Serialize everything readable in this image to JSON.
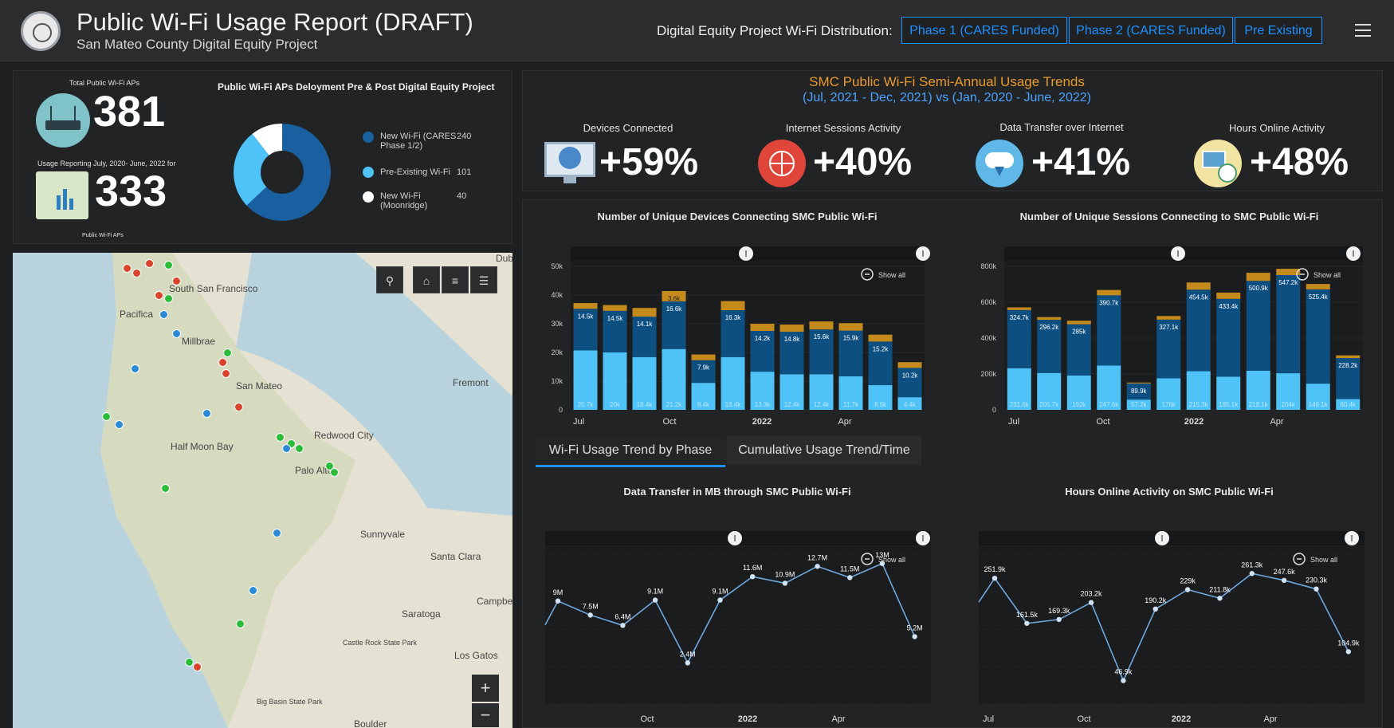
{
  "header": {
    "title": "Public Wi-Fi Usage Report (DRAFT)",
    "subtitle": "San Mateo County Digital Equity Project",
    "distribution_label": "Digital Equity Project Wi-Fi Distribution:",
    "buttons": [
      "Phase 1 (CARES Funded)",
      "Phase 2 (CARES Funded)",
      "Pre Existing"
    ],
    "accent": "#1e90ff"
  },
  "summary": {
    "total_label": "Total Public Wi-Fi APs",
    "total_value": "381",
    "usage_label": "Usage Reporting July, 2020- June, 2022 for",
    "usage_value": "333",
    "usage_footer": "Public Wi-Fi APs",
    "donut_title": "Public Wi-Fi APs Deloyment Pre & Post Digital Equity Project",
    "legend": [
      {
        "label": "New Wi-Fi (CARES Phase 1/2)",
        "value": "240",
        "color": "#1a5fa0"
      },
      {
        "label": "Pre-Existing Wi-Fi",
        "value": "101",
        "color": "#4fc3f7"
      },
      {
        "label": "New Wi-Fi (Moonridge)",
        "value": "40",
        "color": "#ffffff"
      }
    ]
  },
  "trends": {
    "title": "SMC Public Wi-Fi Semi-Annual Usage Trends",
    "subtitle": "(Jul, 2021 - Dec, 2021) vs (Jan, 2020 - June, 2022)",
    "kpis": [
      {
        "label": "Devices Connected",
        "value": "+59%",
        "icon": "monitor-icon"
      },
      {
        "label": "Internet Sessions Activity",
        "value": "+40%",
        "icon": "globe-icon"
      },
      {
        "label": "Data Transfer over Internet",
        "value": "+41%",
        "icon": "cloud-download-icon"
      },
      {
        "label": "Hours Online Activity",
        "value": "+48%",
        "icon": "clock-icon"
      }
    ]
  },
  "tabs": [
    "Wi-Fi Usage Trend by Phase",
    "Cumulative Usage Trend/Time"
  ],
  "show_all": "Show all",
  "chart_data": [
    {
      "type": "bar",
      "title": "Number of Unique Devices Connecting SMC Public Wi-Fi",
      "ylim": [
        0,
        50000
      ],
      "yticks": [
        "0",
        "10k",
        "20k",
        "30k",
        "40k",
        "50k"
      ],
      "xticks": [
        "Jul",
        "Oct",
        "2022",
        "Apr"
      ],
      "series": [
        {
          "color": "#4fc3f7",
          "values": [
            20700,
            20000,
            18400,
            21200,
            9400,
            18400,
            13300,
            12400,
            12400,
            11700,
            8600,
            4400
          ],
          "labels": [
            "20.7k",
            "20k",
            "18.4k",
            "21.2k",
            "9.4k",
            "18.4k",
            "13.3k",
            "12.4k",
            "12.4k",
            "11.7k",
            "8.6k",
            "4.4k"
          ]
        },
        {
          "color": "#0d4f80",
          "values": [
            14500,
            14500,
            14100,
            16600,
            7900,
            16300,
            14200,
            14800,
            15600,
            15900,
            15200,
            10200
          ],
          "labels": [
            "14.5k",
            "14.5k",
            "14.1k",
            "16.6k",
            "7.9k",
            "16.3k",
            "14.2k",
            "14.8k",
            "15.6k",
            "15.9k",
            "15.2k",
            "10.2k"
          ]
        },
        {
          "color": "#c58a1c",
          "values": [
            2000,
            2000,
            3000,
            3600,
            2000,
            3200,
            2500,
            2500,
            2800,
            2600,
            2400,
            2000
          ],
          "labels": [
            "",
            "",
            "",
            "3.6k",
            "",
            "",
            "",
            "",
            "",
            "",
            "",
            ""
          ]
        }
      ]
    },
    {
      "type": "bar",
      "title": "Number of Unique Sessions Connecting to SMC Public Wi-Fi",
      "ylim": [
        0,
        800000
      ],
      "yticks": [
        "0",
        "200k",
        "400k",
        "600k",
        "800k"
      ],
      "xticks": [
        "Jul",
        "Oct",
        "2022",
        "Apr"
      ],
      "series": [
        {
          "color": "#4fc3f7",
          "values": [
            231600,
            205700,
            192000,
            247600,
            57200,
            176000,
            215300,
            185100,
            218100,
            204000,
            146100,
            60400
          ],
          "labels": [
            "231.6k",
            "205.7k",
            "192k",
            "247.6k",
            "57.2k",
            "176k",
            "215.3k",
            "185.1k",
            "218.1k",
            "204k",
            "146.1k",
            "60.4k"
          ]
        },
        {
          "color": "#0d4f80",
          "values": [
            324700,
            296200,
            285000,
            390700,
            89900,
            327100,
            454500,
            433400,
            500900,
            547200,
            525400,
            228200
          ],
          "labels": [
            "324.7k",
            "296.2k",
            "285k",
            "390.7k",
            "89.9k",
            "327.1k",
            "454.5k",
            "433.4k",
            "500.9k",
            "547.2k",
            "525.4k",
            "228.2k"
          ]
        },
        {
          "color": "#c58a1c",
          "values": [
            15000,
            15000,
            20000,
            30000,
            5000,
            20000,
            40000,
            35000,
            45000,
            35000,
            30000,
            15000
          ],
          "labels": [
            "",
            "",
            "",
            "",
            "",
            "",
            "",
            "",
            "",
            "",
            "",
            ""
          ]
        }
      ]
    },
    {
      "type": "line",
      "title": "Data Transfer in MB through SMC Public Wi-Fi",
      "xticks": [
        "Oct",
        "2022",
        "Apr"
      ],
      "values": [
        9.0,
        7.5,
        6.4,
        9.1,
        2.4,
        9.1,
        11.6,
        10.9,
        12.7,
        11.5,
        13.0,
        5.2
      ],
      "labels": [
        "9M",
        "7.5M",
        "6.4M",
        "9.1M",
        "2.4M",
        "9.1M",
        "11.6M",
        "10.9M",
        "12.7M",
        "11.5M",
        "13M",
        "5.2M"
      ],
      "color": "#6fa8dc"
    },
    {
      "type": "line",
      "title": "Hours Online Activity on SMC Public Wi-Fi",
      "xticks": [
        "Jul",
        "Oct",
        "2022",
        "Apr"
      ],
      "values": [
        251.9,
        161.5,
        169.3,
        203.2,
        46.9,
        190.2,
        229,
        211.8,
        261.3,
        247.6,
        230.3,
        104.9
      ],
      "labels": [
        "251.9k",
        "161.5k",
        "169.3k",
        "203.2k",
        "46.9k",
        "190.2k",
        "229k",
        "211.8k",
        "261.3k",
        "247.6k",
        "230.3k",
        "104.9k"
      ],
      "color": "#6fa8dc"
    }
  ],
  "map": {
    "labels": [
      "South San Francisco",
      "Pacifica",
      "Millbrae",
      "San Mateo",
      "Half Moon Bay",
      "Redwood City",
      "Palo Alto",
      "Fremont",
      "Sunnyvale",
      "Santa Clara",
      "Saratoga",
      "Los Gatos",
      "Boulder",
      "Big Basin State Park",
      "Campbell",
      "Castle Rock State Park",
      "Dub"
    ]
  }
}
